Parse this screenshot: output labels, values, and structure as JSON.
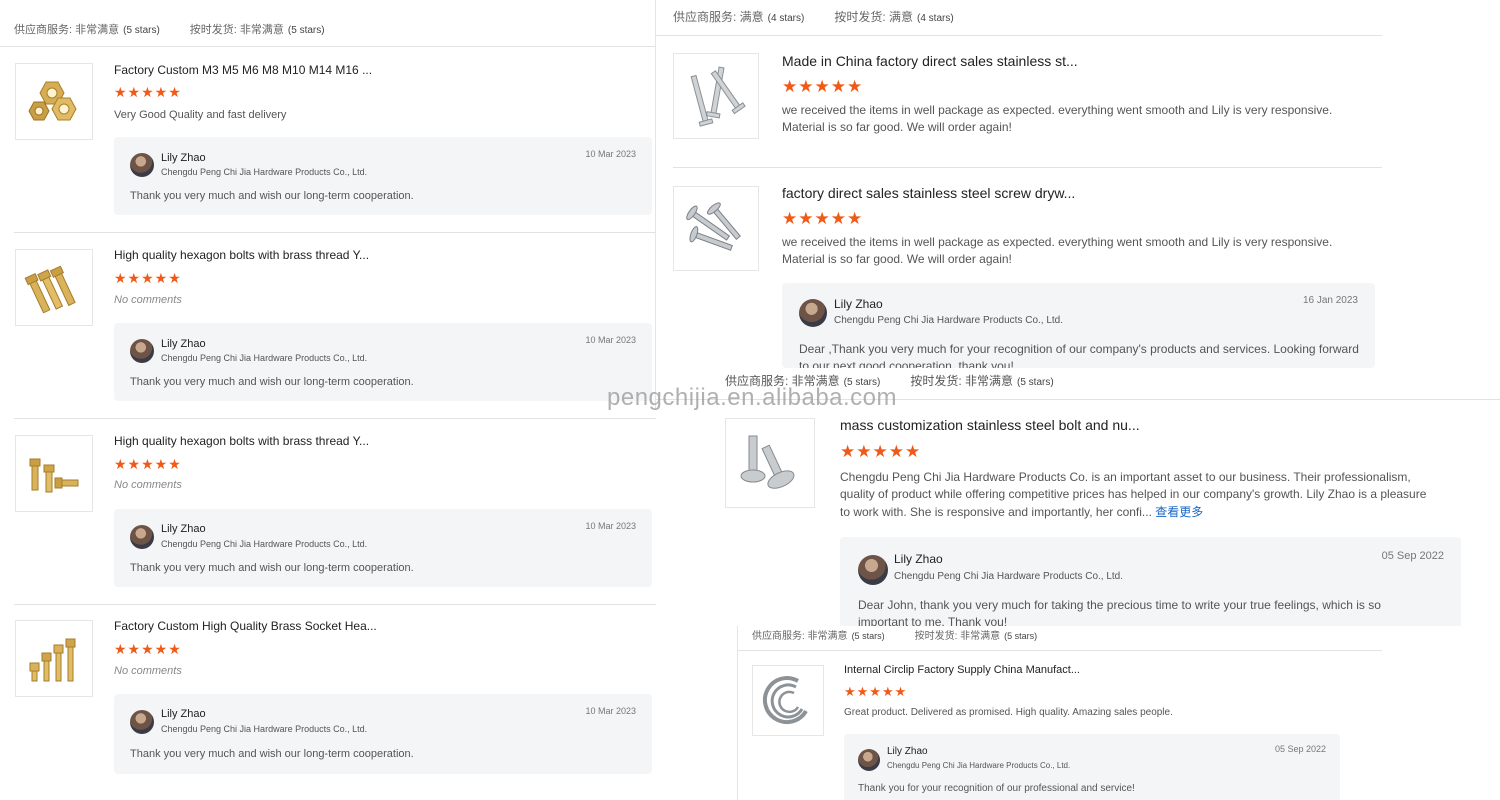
{
  "colors": {
    "star": "#f05a19",
    "link": "#1a66c8",
    "reply_bg": "#f4f5f7"
  },
  "watermark": "pengchijia.en.alibaba.com",
  "stars_glyph": "★★★★★",
  "left": {
    "summary": {
      "service_label": "供应商服务: 非常满意",
      "service_note": "(5 stars)",
      "delivery_label": "按时发货: 非常满意",
      "delivery_note": "(5 stars)"
    },
    "reviews": [
      {
        "title": "Factory Custom M3 M5 M6 M8 M10 M14 M16 ...",
        "rating": 5,
        "comment": "Very Good Quality and fast delivery",
        "reply": {
          "name": "Lily Zhao",
          "company": "Chengdu Peng Chi Jia Hardware Products Co., Ltd.",
          "date": "10 Mar 2023",
          "text": "Thank you very much and wish our long-term cooperation."
        }
      },
      {
        "title": "High quality hexagon bolts with brass thread Y...",
        "rating": 5,
        "comment": "No comments",
        "reply": {
          "name": "Lily Zhao",
          "company": "Chengdu Peng Chi Jia Hardware Products Co., Ltd.",
          "date": "10 Mar 2023",
          "text": "Thank you very much and wish our long-term cooperation."
        }
      },
      {
        "title": "High quality hexagon bolts with brass thread Y...",
        "rating": 5,
        "comment": "No comments",
        "reply": {
          "name": "Lily Zhao",
          "company": "Chengdu Peng Chi Jia Hardware Products Co., Ltd.",
          "date": "10 Mar 2023",
          "text": "Thank you very much and wish our long-term cooperation."
        }
      },
      {
        "title": "Factory Custom High Quality Brass Socket Hea...",
        "rating": 5,
        "comment": "No comments",
        "reply": {
          "name": "Lily Zhao",
          "company": "Chengdu Peng Chi Jia Hardware Products Co., Ltd.",
          "date": "10 Mar 2023",
          "text": "Thank you very much and wish our long-term cooperation."
        }
      }
    ]
  },
  "right_top": {
    "summary": {
      "service_label": "供应商服务: 满意",
      "service_note": "(4 stars)",
      "delivery_label": "按时发货: 满意",
      "delivery_note": "(4 stars)"
    },
    "reviews": [
      {
        "title": "Made in China factory direct sales stainless st...",
        "rating": 5,
        "comment": "we received the items in well package as expected. everything went smooth and Lily is very responsive. Material is so far good. We will order again!"
      },
      {
        "title": "factory direct sales stainless steel screw dryw...",
        "rating": 5,
        "comment": "we received the items in well package as expected. everything went smooth and Lily is very responsive. Material is so far good. We will order again!",
        "reply": {
          "name": "Lily Zhao",
          "company": "Chengdu Peng Chi Jia Hardware Products Co., Ltd.",
          "date": "16 Jan 2023",
          "text": "Dear ,Thank you very much for your recognition of our company's products and services. Looking forward to our next good cooperation. thank you!"
        }
      }
    ]
  },
  "right_middle": {
    "summary": {
      "service_label": "供应商服务: 非常满意",
      "service_note": "(5 stars)",
      "delivery_label": "按时发货: 非常满意",
      "delivery_note": "(5 stars)"
    },
    "review": {
      "title": "mass customization stainless steel bolt and nu...",
      "rating": 5,
      "comment": "Chengdu Peng Chi Jia Hardware Products Co. is an important asset to our business.  Their professionalism, quality of product while offering competitive prices has helped in our company's growth.  Lily Zhao is a pleasure to work with.  She is responsive and importantly, her confi...",
      "more_link": "查看更多",
      "reply": {
        "name": "Lily Zhao",
        "company": "Chengdu Peng Chi Jia Hardware Products Co., Ltd.",
        "date": "05 Sep 2022",
        "text": "Dear John, thank you very much for taking the precious time to write your true feelings, which is so important to me. Thank you!"
      }
    }
  },
  "right_bottom": {
    "summary": {
      "service_label": "供应商服务: 非常满意",
      "service_note": "(5 stars)",
      "delivery_label": "按时发货: 非常满意",
      "delivery_note": "(5 stars)"
    },
    "review": {
      "title": "Internal Circlip Factory Supply China Manufact...",
      "rating": 5,
      "comment": "Great product. Delivered as promised. High quality. Amazing sales people.",
      "reply": {
        "name": "Lily Zhao",
        "company": "Chengdu Peng Chi Jia Hardware Products Co., Ltd.",
        "date": "05 Sep 2022",
        "text": "Thank you for your recognition of our professional and service!"
      }
    }
  }
}
